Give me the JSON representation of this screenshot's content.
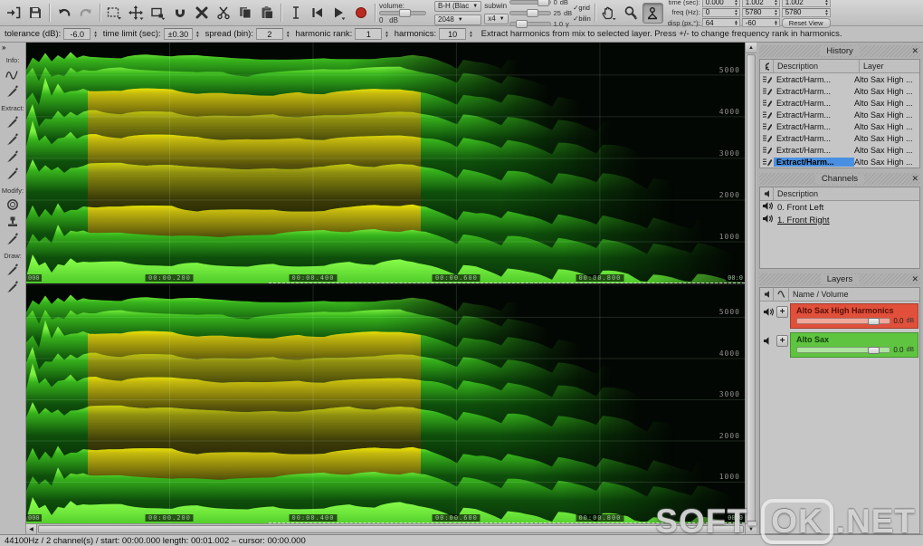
{
  "toolbar": {
    "volume_label": "volume:",
    "volume_value": "0",
    "volume_unit": "dB",
    "window_select": "B-H (Blac",
    "fft_size": "2048",
    "subwin_label": "subwin",
    "subwin_mult": "x4",
    "sliders": [
      {
        "value": "0",
        "unit": "dB"
      },
      {
        "value": "25",
        "unit": "dB"
      },
      {
        "value": "1.0",
        "unit": "γ"
      }
    ],
    "checkboxes": [
      {
        "label": "grid",
        "checked": "✓"
      },
      {
        "label": "bilin",
        "checked": "✓"
      }
    ],
    "nav_rows": [
      {
        "label": "time (sec):",
        "v1": "0.000",
        "v2": "1.002",
        "v3": "1.002",
        "button": ""
      },
      {
        "label": "freq (Hz):",
        "v1": "0",
        "v2": "5780",
        "v3": "5780",
        "button": ""
      },
      {
        "label": "disp (px,°):",
        "v1": "64",
        "v2": "-60",
        "v3": "",
        "button": "Reset View"
      }
    ]
  },
  "params": {
    "items": [
      {
        "label": "tolerance (dB):",
        "value": "-6.0"
      },
      {
        "label": "time limit (sec):",
        "value": "±0.30"
      },
      {
        "label": "spread (bin):",
        "value": "2"
      },
      {
        "label": "harmonic rank:",
        "value": "1"
      },
      {
        "label": "harmonics:",
        "value": "10"
      }
    ],
    "help": "Extract harmonics from mix to selected layer. Press +/- to change frequency rank in harmonics."
  },
  "sidebar": {
    "collapse": "»",
    "sections": [
      {
        "label": "Info:",
        "tools": [
          "spectrum-curve-tool",
          "info-brush-tool"
        ]
      },
      {
        "label": "Extract:",
        "tools": [
          "extract-area-brush",
          "extract-line-brush",
          "extract-list-brush",
          "extract-harmonics-brush"
        ]
      },
      {
        "label": "Modify:",
        "tools": [
          "modify-circle-tool",
          "modify-stamp-tool",
          "modify-brush-tool"
        ]
      },
      {
        "label": "Draw:",
        "tools": [
          "draw-brush-tool",
          "draw-spray-tool"
        ]
      }
    ]
  },
  "spectrogram": {
    "freq_ticks": [
      "5000",
      "4000",
      "3000",
      "2000",
      "1000"
    ],
    "freq_values": [
      5000,
      4000,
      3000,
      2000,
      1000
    ],
    "freq_max": 5780,
    "time_ticks": [
      "00:00.200",
      "00:00.400",
      "00:00.600",
      "00:00.800"
    ],
    "time_values": [
      0.2,
      0.4,
      0.6,
      0.8
    ],
    "time_max": 1.002,
    "time_left_edge": "000",
    "time_right_edge": "00:0"
  },
  "panels": {
    "history": {
      "title": "History",
      "columns": [
        "Description",
        "Layer"
      ],
      "rows": [
        {
          "desc": "Extract/Harm...",
          "layer": "Alto Sax High ..."
        },
        {
          "desc": "Extract/Harm...",
          "layer": "Alto Sax High ..."
        },
        {
          "desc": "Extract/Harm...",
          "layer": "Alto Sax High ..."
        },
        {
          "desc": "Extract/Harm...",
          "layer": "Alto Sax High ..."
        },
        {
          "desc": "Extract/Harm...",
          "layer": "Alto Sax High ..."
        },
        {
          "desc": "Extract/Harm...",
          "layer": "Alto Sax High ..."
        },
        {
          "desc": "Extract/Harm...",
          "layer": "Alto Sax High ..."
        },
        {
          "desc": "Extract/Harm...",
          "layer": "Alto Sax High ..."
        }
      ],
      "selected_index": 7,
      "selected_color": "#4a90e2"
    },
    "channels": {
      "title": "Channels",
      "column": "Description",
      "rows": [
        "0. Front Left",
        "1. Front Right"
      ],
      "selected_index": 1
    },
    "layers": {
      "title": "Layers",
      "column": "Name / Volume",
      "rows": [
        {
          "name": "Alto Sax High Harmonics",
          "color": "#e0503a",
          "name_color": "#58100a",
          "volume": "0.0",
          "unit": "dB",
          "speaker": "loud"
        },
        {
          "name": "Alto Sax",
          "color": "#5fc440",
          "name_color": "#123f0a",
          "volume": "0.0",
          "unit": "dB",
          "speaker": "quiet"
        }
      ]
    }
  },
  "statusbar": {
    "text": "44100Hz / 2 channel(s) / start: 00:00.000 length:  00:01.002 – cursor:  00:00.000"
  },
  "watermark": {
    "part1": "SOFT-",
    "part2": "OK",
    "part3": ".NET"
  },
  "colors": {
    "spec_green_crest": "#7df23f",
    "spec_yellow_crest": "#f8f000",
    "spec_background": "#030703"
  }
}
